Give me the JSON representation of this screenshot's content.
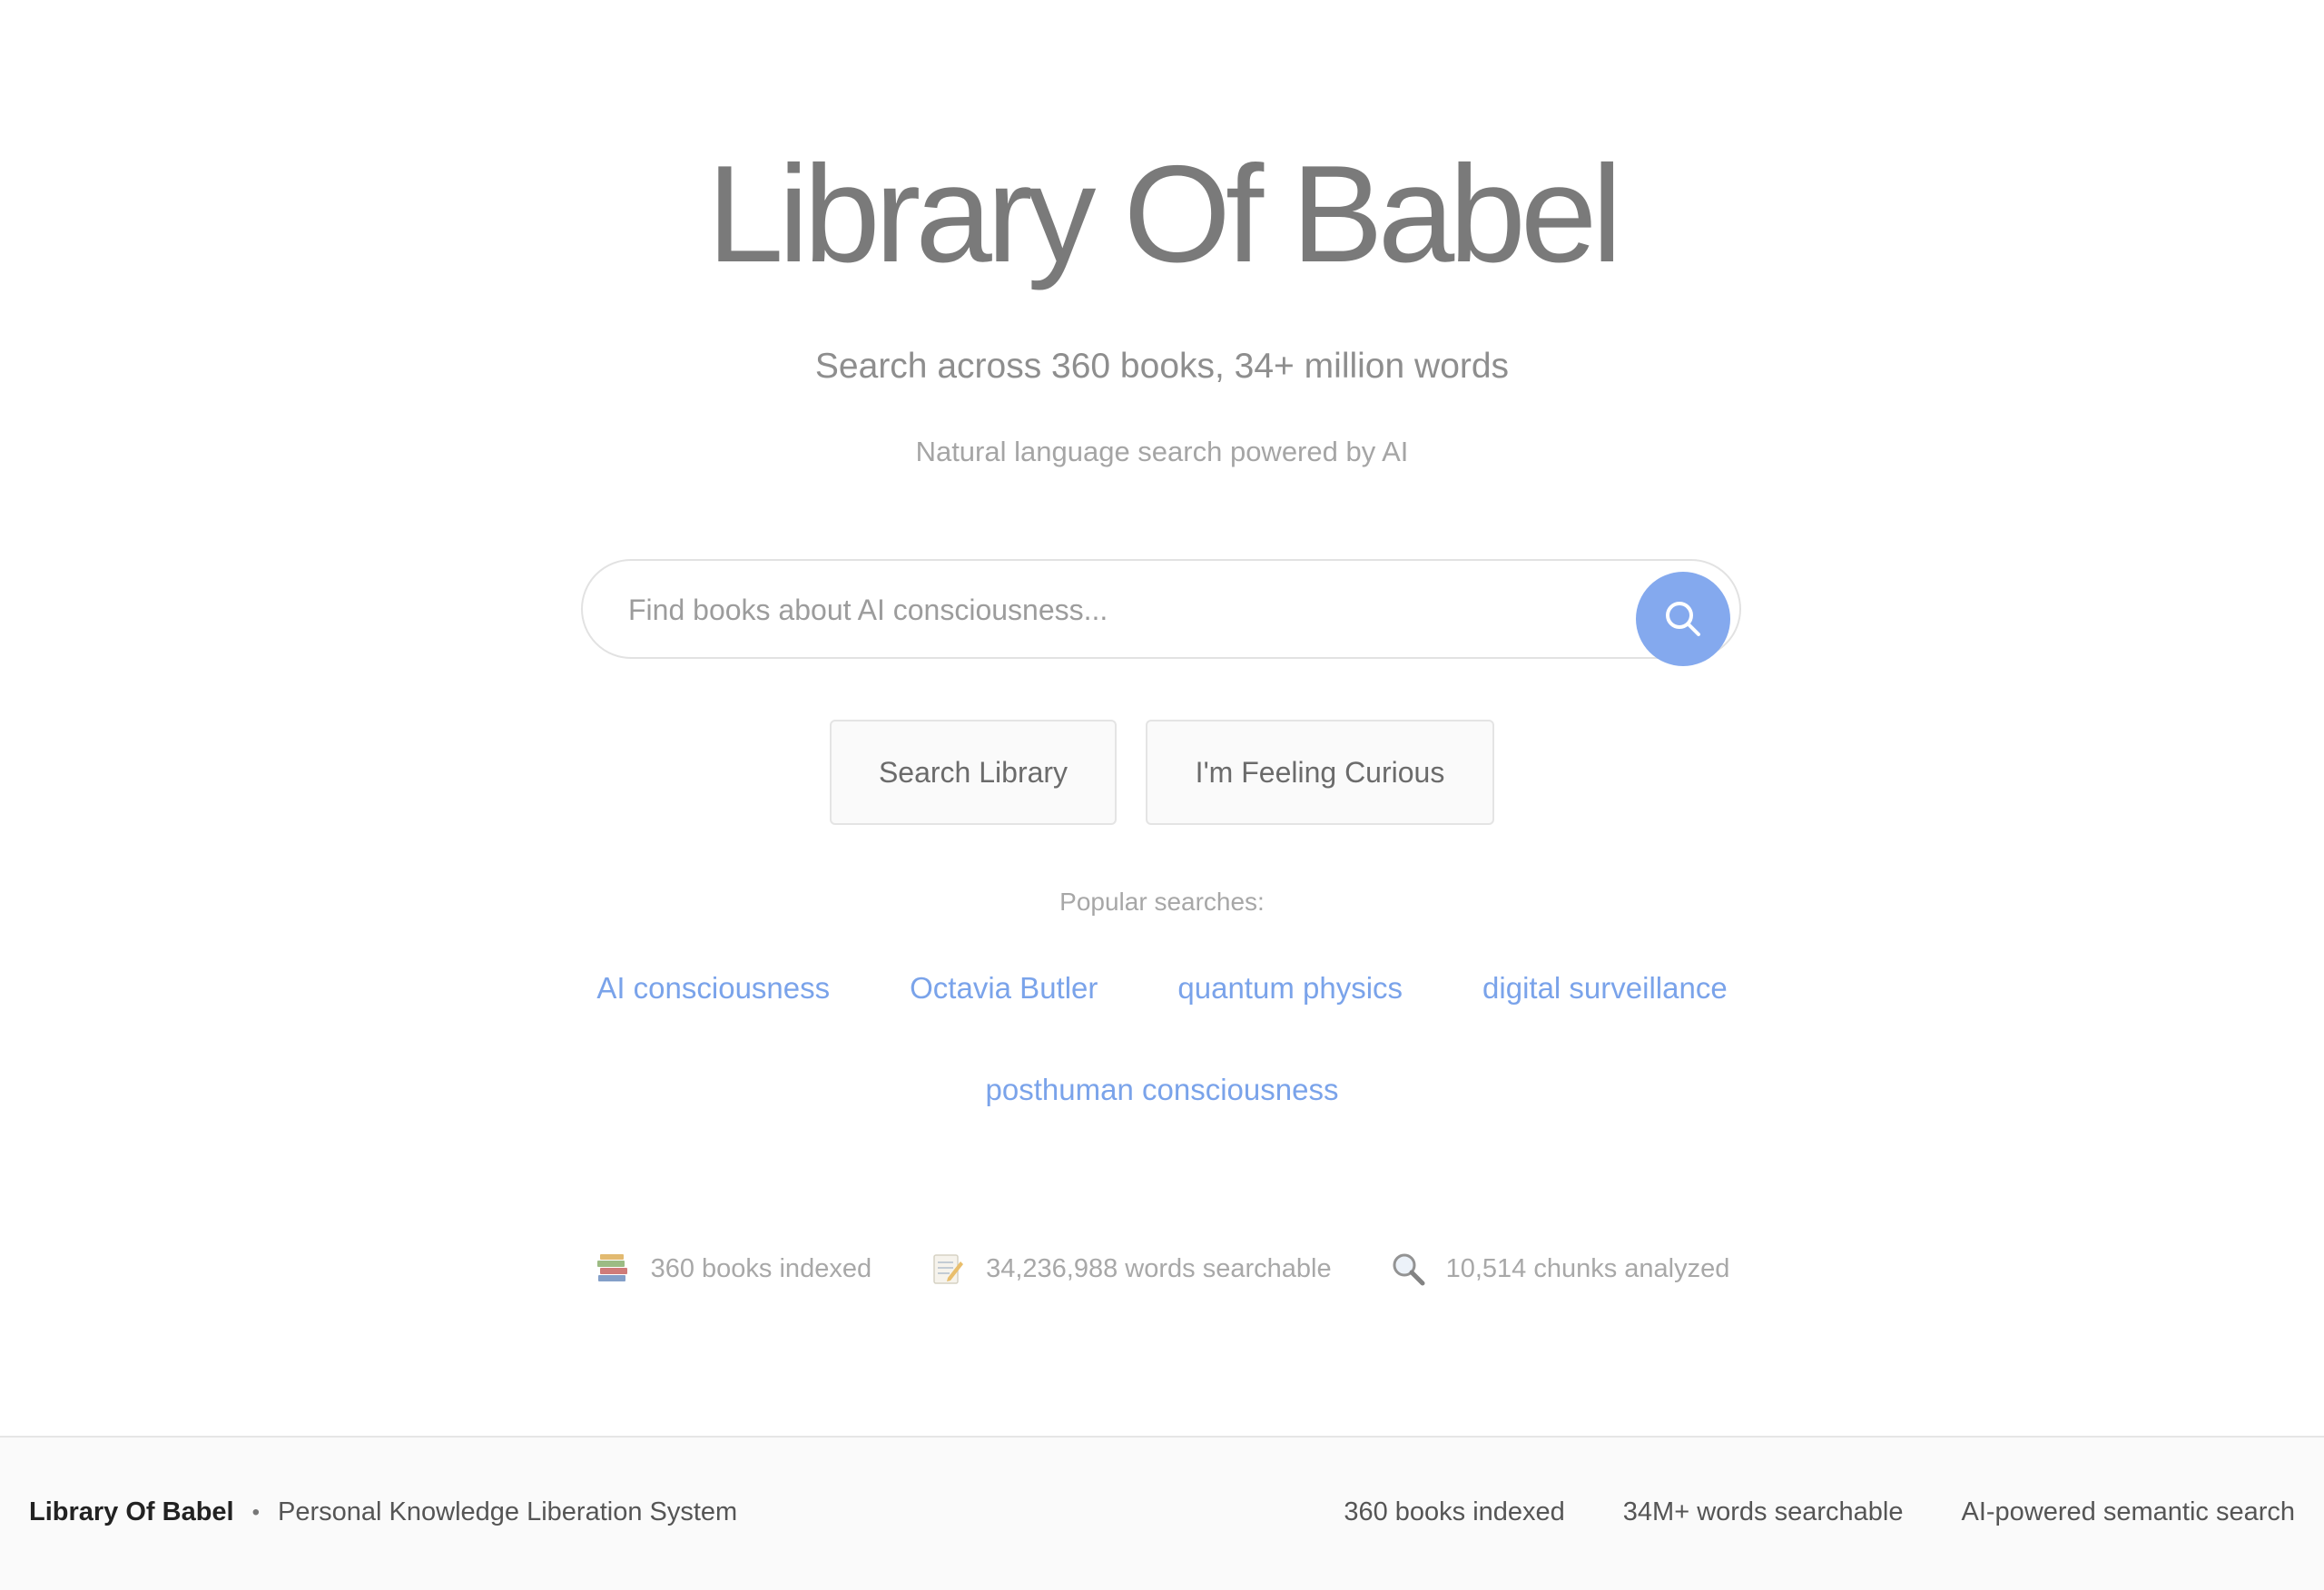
{
  "hero": {
    "title": "Library Of Babel",
    "subtitle": "Search across 360 books, 34+ million words",
    "tagline": "Natural language search powered by AI"
  },
  "search": {
    "placeholder": "Find books about AI consciousness...",
    "button_icon": "search-icon"
  },
  "actions": {
    "search_label": "Search Library",
    "curious_label": "I'm Feeling Curious"
  },
  "popular": {
    "label": "Popular searches:",
    "items": [
      "AI consciousness",
      "Octavia Butler",
      "quantum physics",
      "digital surveillance",
      "posthuman consciousness"
    ]
  },
  "stats": [
    {
      "icon": "books-icon",
      "text": "360 books indexed"
    },
    {
      "icon": "memo-icon",
      "text": "34,236,988 words searchable"
    },
    {
      "icon": "magnifier-icon",
      "text": "10,514 chunks analyzed"
    }
  ],
  "footer": {
    "brand": "Library Of Babel",
    "separator": "•",
    "tagline": "Personal Knowledge Liberation System",
    "stats": [
      "360 books indexed",
      "34M+ words searchable",
      "AI-powered semantic search"
    ]
  },
  "colors": {
    "accent": "#84a9ee",
    "link": "#7aa3ea",
    "title": "#7a7a7a"
  }
}
